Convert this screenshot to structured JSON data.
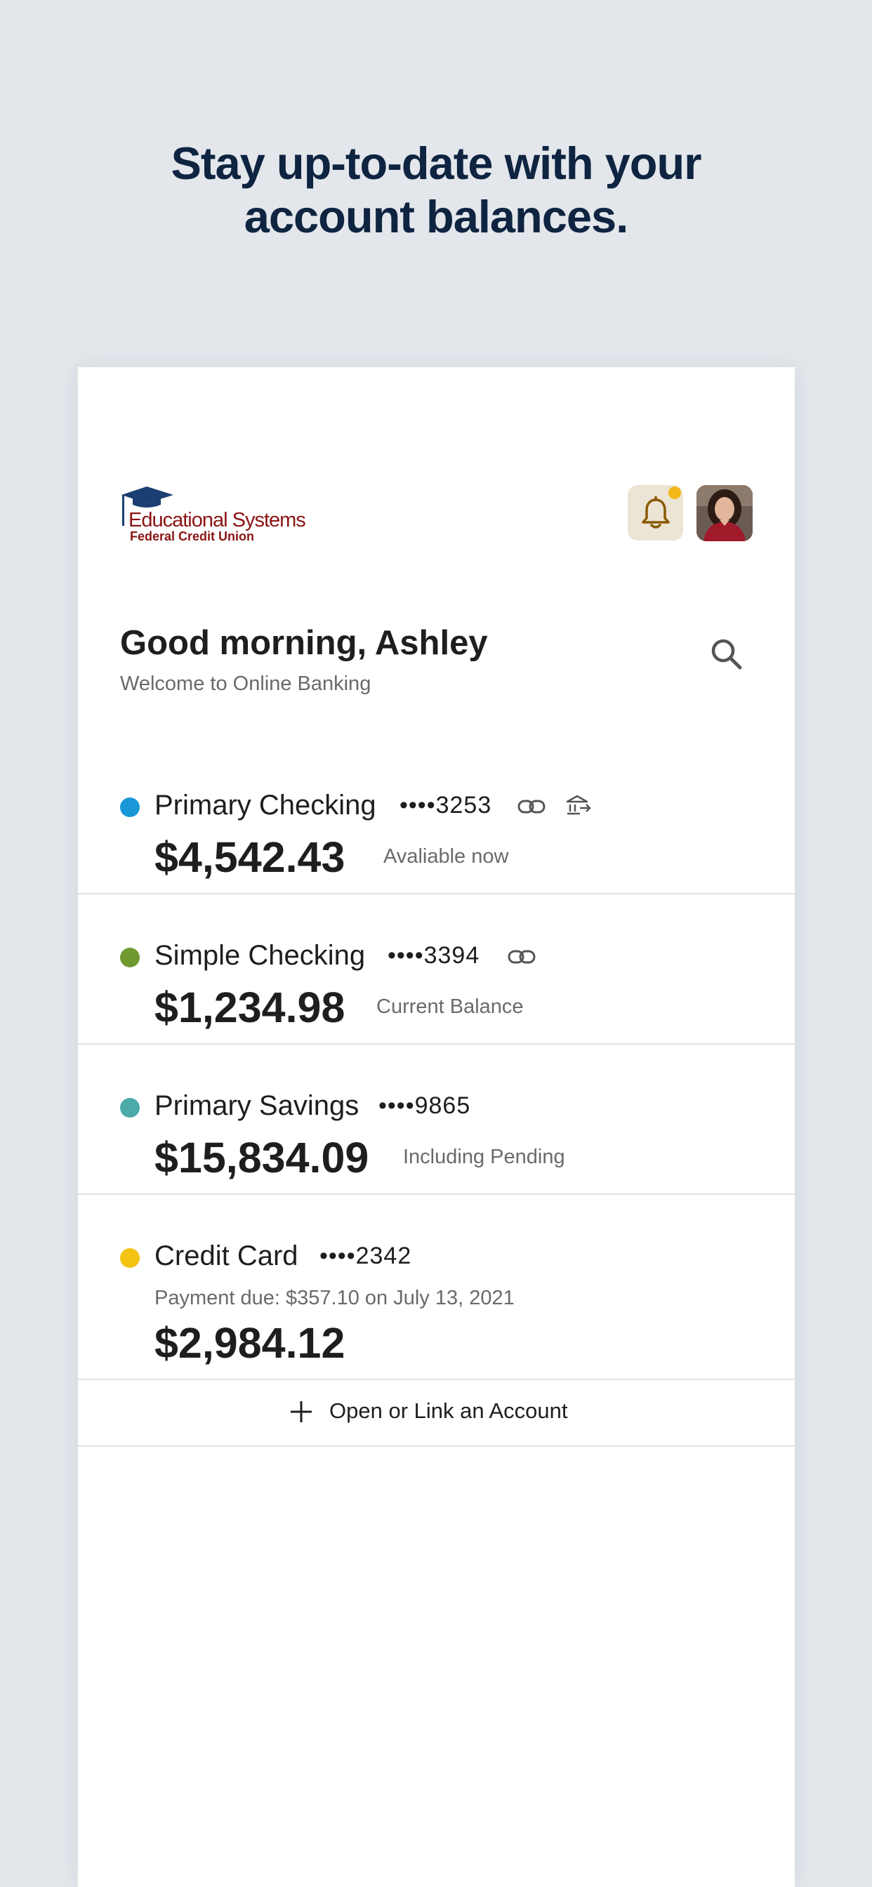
{
  "headline": {
    "line1": "Stay up-to-date with your",
    "line2": "account balances."
  },
  "logo": {
    "name": "Educational Systems",
    "subname": "Federal Credit Union",
    "brand_color": "#8b1414",
    "cap_color": "#1b3f73"
  },
  "header": {
    "notification_icon": "bell-icon",
    "has_unread": true,
    "unread_color": "#f2b815"
  },
  "greeting": {
    "title": "Good morning, Ashley",
    "subtitle": "Welcome to Online Banking"
  },
  "accounts": [
    {
      "name": "Primary Checking",
      "mask": "••••3253",
      "balance": "$4,542.43",
      "note": "Avaliable now",
      "dot_color": "#1a97d6",
      "icons": [
        "link-icon",
        "bank-transfer-icon"
      ]
    },
    {
      "name": "Simple Checking",
      "mask": "••••3394",
      "balance": "$1,234.98",
      "note": "Current Balance",
      "dot_color": "#6e9a2f",
      "icons": [
        "link-icon"
      ]
    },
    {
      "name": "Primary Savings",
      "mask": "••••9865",
      "balance": "$15,834.09",
      "note": "Including Pending",
      "dot_color": "#4aaba8",
      "icons": []
    },
    {
      "name": "Credit Card",
      "mask": "••••2342",
      "payment_due": "Payment due: $357.10 on July 13, 2021",
      "balance": "$2,984.12",
      "dot_color": "#f5c313",
      "icons": []
    }
  ],
  "actions": {
    "open_link_label": "Open or Link an Account"
  }
}
